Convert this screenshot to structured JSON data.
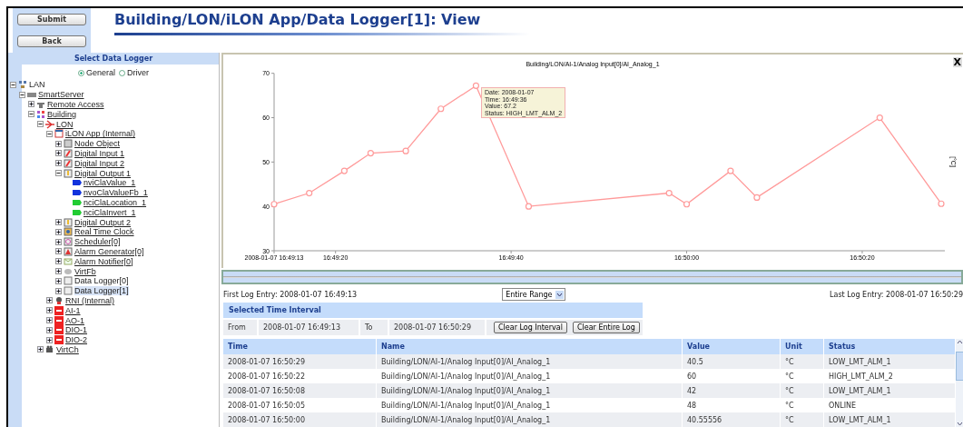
{
  "top_bar": {
    "buttons": [
      "Submit",
      "Back"
    ],
    "title": "Building/LON/iLON App/Data Logger[1]: View"
  },
  "sidebar": {
    "header": "Select Data Logger",
    "radios": [
      {
        "label": "General",
        "selected": true
      },
      {
        "label": "Driver",
        "selected": false
      }
    ],
    "tree": [
      {
        "label": "LAN",
        "kind": "network",
        "expanded": true,
        "linked": false,
        "selected": false,
        "children": [
          {
            "label": "SmartServer",
            "kind": "server",
            "expanded": true,
            "linked": true,
            "selected": false,
            "children": [
              {
                "label": "Remote Access",
                "kind": "phone",
                "expanded": false,
                "linked": true,
                "selected": false
              },
              {
                "label": "Building",
                "kind": "building",
                "expanded": true,
                "linked": true,
                "selected": false,
                "children": [
                  {
                    "label": "LON",
                    "kind": "lon",
                    "expanded": true,
                    "linked": true,
                    "selected": false,
                    "children": [
                      {
                        "label": "iLON App (Internal)",
                        "kind": "app",
                        "expanded": true,
                        "linked": true,
                        "selected": false,
                        "children": [
                          {
                            "label": "Node Object",
                            "kind": "block",
                            "expanded": false,
                            "linked": true,
                            "selected": false
                          },
                          {
                            "label": "Digital Input 1",
                            "kind": "input",
                            "expanded": false,
                            "linked": true,
                            "selected": false
                          },
                          {
                            "label": "Digital Input 2",
                            "kind": "input",
                            "expanded": false,
                            "linked": true,
                            "selected": false
                          },
                          {
                            "label": "Digital Output 1",
                            "kind": "output",
                            "expanded": true,
                            "linked": true,
                            "selected": false,
                            "children": [
                              {
                                "label": "nviClaValue_1",
                                "kind": "flag-blue",
                                "linked": true,
                                "selected": false
                              },
                              {
                                "label": "nvoClaValueFb_1",
                                "kind": "flag-blue",
                                "linked": true,
                                "selected": false
                              },
                              {
                                "label": "nciClaLocation_1",
                                "kind": "flag-green",
                                "linked": true,
                                "selected": false
                              },
                              {
                                "label": "nciClaInvert_1",
                                "kind": "flag-green",
                                "linked": true,
                                "selected": false
                              }
                            ]
                          },
                          {
                            "label": "Digital Output 2",
                            "kind": "output",
                            "expanded": false,
                            "linked": true,
                            "selected": false
                          },
                          {
                            "label": "Real Time Clock",
                            "kind": "clock",
                            "expanded": false,
                            "linked": true,
                            "selected": false
                          },
                          {
                            "label": "Scheduler[0]",
                            "kind": "scheduler",
                            "expanded": false,
                            "linked": true,
                            "selected": false
                          },
                          {
                            "label": "Alarm Generator[0]",
                            "kind": "alarm",
                            "expanded": false,
                            "linked": true,
                            "selected": false
                          },
                          {
                            "label": "Alarm Notifier[0]",
                            "kind": "mail",
                            "expanded": false,
                            "linked": true,
                            "selected": false
                          },
                          {
                            "label": "VirtFb",
                            "kind": "virtfb",
                            "expanded": false,
                            "linked": true,
                            "selected": false
                          },
                          {
                            "label": "Data Logger[0]",
                            "kind": "logger",
                            "expanded": false,
                            "linked": false,
                            "selected": false
                          },
                          {
                            "label": "Data Logger[1]",
                            "kind": "logger",
                            "expanded": false,
                            "linked": false,
                            "selected": true
                          }
                        ]
                      },
                      {
                        "label": "RNI (Internal)",
                        "kind": "rni",
                        "expanded": false,
                        "linked": true,
                        "selected": false
                      },
                      {
                        "label": "AI-1",
                        "kind": "device",
                        "expanded": false,
                        "linked": true,
                        "selected": false
                      },
                      {
                        "label": "AO-1",
                        "kind": "device",
                        "expanded": false,
                        "linked": true,
                        "selected": false
                      },
                      {
                        "label": "DIO-1",
                        "kind": "device",
                        "expanded": false,
                        "linked": true,
                        "selected": false
                      },
                      {
                        "label": "DIO-2",
                        "kind": "device",
                        "expanded": false,
                        "linked": true,
                        "selected": false
                      }
                    ]
                  },
                  {
                    "label": "VirtCh",
                    "kind": "virtch",
                    "expanded": false,
                    "linked": true,
                    "selected": false
                  }
                ]
              }
            ]
          }
        ]
      }
    ]
  },
  "chart": {
    "chart_data": {
      "type": "line",
      "title": "Building/LON/AI-1/Analog Input[0]/AI_Analog_1",
      "ylabel": "[°C]",
      "x": [
        60553,
        60557,
        60561,
        60564,
        60568,
        60572,
        60576,
        60582,
        60598,
        60600,
        60605,
        60608,
        60622,
        60629
      ],
      "series": [
        {
          "color": "#ff9a9a",
          "marker": "circle",
          "values": [
            40.5,
            43,
            48,
            52,
            52.5,
            62,
            67.2,
            40,
            43,
            40.5,
            48,
            42,
            60,
            40.6
          ]
        }
      ],
      "xlim": [
        60553,
        60629
      ],
      "ylim": [
        30,
        70
      ],
      "xticks": [
        {
          "value": 60553,
          "label": "2008-01-07 16:49:13"
        },
        {
          "value": 60560,
          "label": "16:49:20"
        },
        {
          "value": 60580,
          "label": "16:49:40"
        },
        {
          "value": 60600,
          "label": "16:50:00"
        },
        {
          "value": 60620,
          "label": "16:50:20"
        }
      ],
      "yticks": [
        30,
        40,
        50,
        60,
        70
      ]
    },
    "tooltip": [
      "Date: 2008-01-07",
      "Time: 16:49:36",
      "Value: 67.2",
      "Status: HIGH_LMT_ALM_2"
    ],
    "close": "X"
  },
  "log_range": {
    "first": "First Log Entry: 2008-01-07 16:49:13",
    "range": "Entire Range",
    "last": "Last Log Entry: 2008-01-07 16:50:29"
  },
  "interval": {
    "header": "Selected Time Interval",
    "from_label": "From",
    "from": "2008-01-07 16:49:13",
    "to_label": "To",
    "to": "2008-01-07 16:50:29",
    "buttons": [
      "Clear Log Interval",
      "Clear Entire Log"
    ]
  },
  "table": {
    "columns": [
      "Time",
      "Name",
      "Value",
      "Unit",
      "Status"
    ],
    "rows": [
      [
        "2008-01-07 16:50:29",
        "Building/LON/AI-1/Analog Input[0]/AI_Analog_1",
        "40.5",
        "°C",
        "LOW_LMT_ALM_1"
      ],
      [
        "2008-01-07 16:50:22",
        "Building/LON/AI-1/Analog Input[0]/AI_Analog_1",
        "60",
        "°C",
        "HIGH_LMT_ALM_2"
      ],
      [
        "2008-01-07 16:50:08",
        "Building/LON/AI-1/Analog Input[0]/AI_Analog_1",
        "42",
        "°C",
        "LOW_LMT_ALM_1"
      ],
      [
        "2008-01-07 16:50:05",
        "Building/LON/AI-1/Analog Input[0]/AI_Analog_1",
        "48",
        "°C",
        "ONLINE"
      ],
      [
        "2008-01-07 16:50:00",
        "Building/LON/AI-1/Analog Input[0]/AI_Analog_1",
        "40.55556",
        "°C",
        "LOW_LMT_ALM_1"
      ]
    ]
  }
}
